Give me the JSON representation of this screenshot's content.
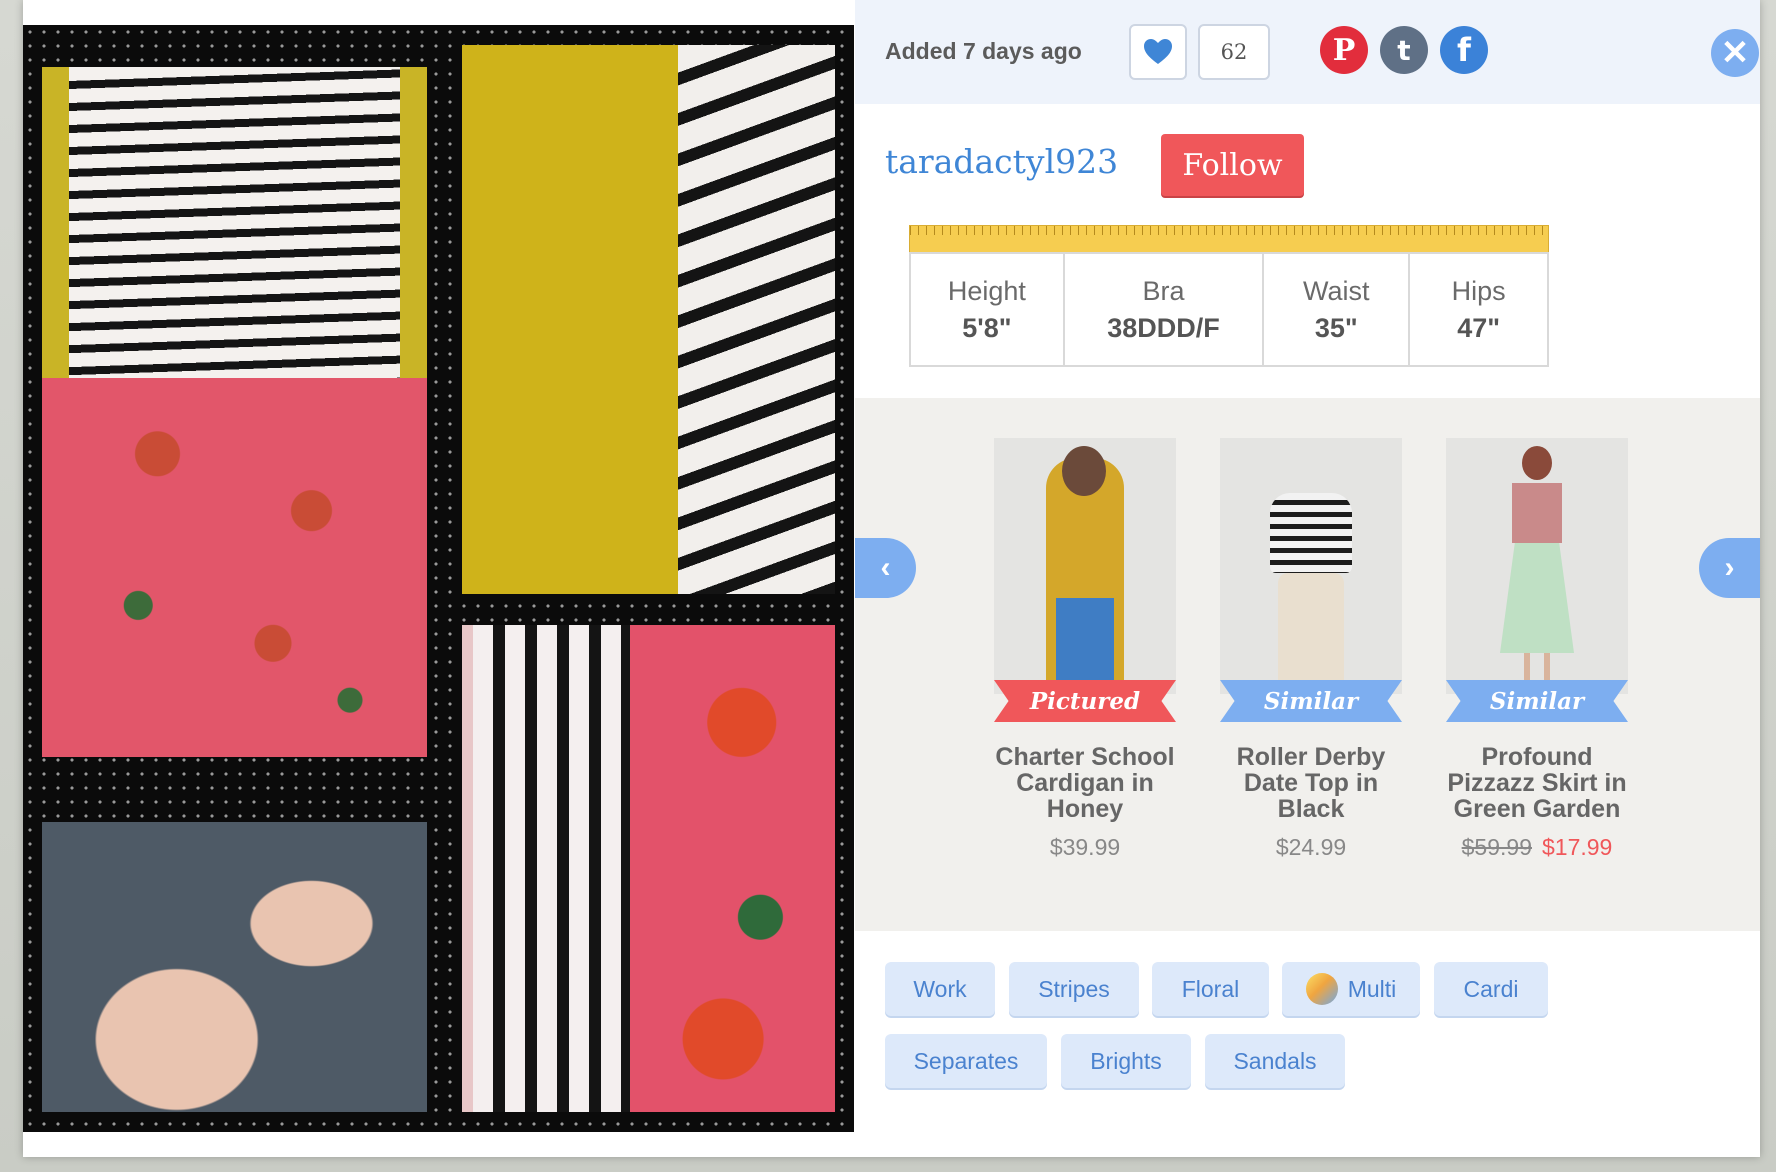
{
  "header": {
    "added_text": "Added 7 days ago",
    "like_count": "62",
    "close_icon": "close-icon",
    "social": {
      "pinterest": "P",
      "tumblr": "t",
      "facebook": "f"
    }
  },
  "user": {
    "username": "taradactyl923",
    "follow_label": "Follow"
  },
  "measurements": [
    {
      "label": "Height",
      "value": "5'8\""
    },
    {
      "label": "Bra",
      "value": "38DDD/F"
    },
    {
      "label": "Waist",
      "value": "35\""
    },
    {
      "label": "Hips",
      "value": "47\""
    }
  ],
  "products": [
    {
      "ribbon": "Pictured",
      "name": "Charter School Cardigan in Honey",
      "price": "$39.99"
    },
    {
      "ribbon": "Similar",
      "name": "Roller Derby Date Top in Black",
      "price": "$24.99"
    },
    {
      "ribbon": "Similar",
      "name": "Profound Pizzazz Skirt in Green Garden",
      "old_price": "$59.99",
      "sale_price": "$17.99"
    }
  ],
  "tags": [
    "Work",
    "Stripes",
    "Floral",
    "Multi",
    "Cardi",
    "Separates",
    "Brights",
    "Sandals"
  ],
  "colors": {
    "accent_blue": "#7daef0",
    "follow_red": "#f0575a",
    "tag_bg": "#dde9fa",
    "ruler_yellow": "#f6cd50"
  }
}
